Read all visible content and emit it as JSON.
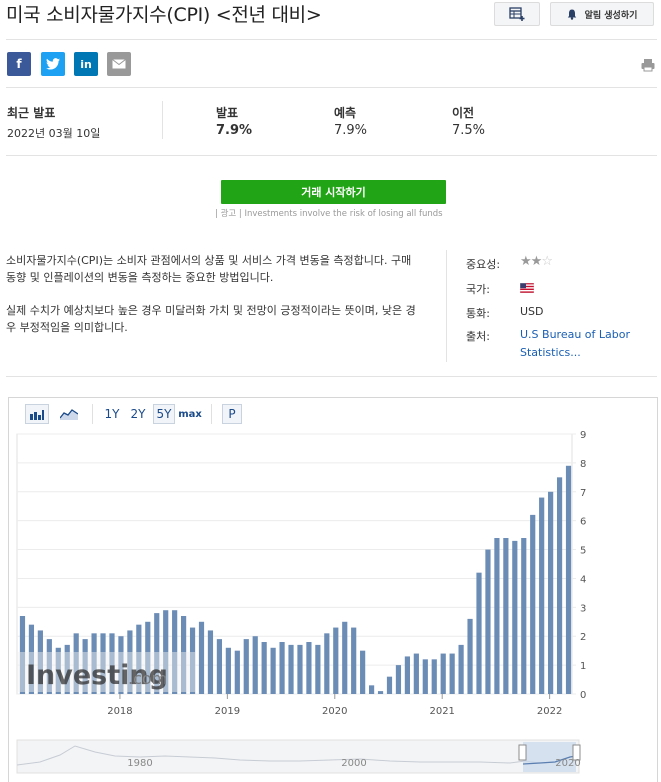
{
  "header": {
    "title": "미국 소비자물가지수(CPI) <전년 대비>",
    "alert_label": "알림 생성하기"
  },
  "share": {
    "facebook": "f",
    "twitter": "t",
    "linkedin": "in"
  },
  "stats": {
    "latest_label": "최근 발표",
    "latest_date": "2022년 03월 10일",
    "actual_label": "발표",
    "actual_value": "7.9%",
    "forecast_label": "예측",
    "forecast_value": "7.9%",
    "previous_label": "이전",
    "previous_value": "7.5%"
  },
  "cta": {
    "label": "거래 시작하기",
    "disclaimer": "| 광고 | Investments involve the risk of losing all funds"
  },
  "description": {
    "p1": "소비자물가지수(CPI)는 소비자 관점에서의 상품 및 서비스 가격 변동을 측정합니다. 구매 동향 및 인플레이션의 변동을 측정하는 중요한 방법입니다.",
    "p2": "실제 수치가 예상치보다 높은 경우 미달러화 가치 및 전망이 긍정적이라는 뜻이며, 낮은 경우 부정적임을 의미합니다."
  },
  "info": {
    "importance_label": "중요성:",
    "importance_stars": 2,
    "country_label": "국가:",
    "currency_label": "통화:",
    "currency_value": "USD",
    "source_label": "출처:",
    "source_value": "U.S Bureau of Labor Statistics..."
  },
  "toolbar": {
    "range_1y": "1Y",
    "range_2y": "2Y",
    "range_5y": "5Y",
    "range_max": "max",
    "p_label": "P",
    "active_range": "5Y"
  },
  "watermark": {
    "brand": "Investing",
    "suffix": ".com"
  },
  "chart_data": {
    "type": "bar",
    "y_ticks": [
      "0",
      "1",
      "2",
      "3",
      "4",
      "5",
      "6",
      "7",
      "8",
      "9"
    ],
    "ylim": [
      0,
      9
    ],
    "x_ticks": [
      "2018",
      "2019",
      "2020",
      "2021",
      "2022"
    ],
    "color": "#6b8cb5",
    "series": [
      {
        "values": [
          2.7,
          2.4,
          2.2,
          1.9,
          1.6,
          1.7,
          2.1,
          1.9,
          2.1,
          2.1,
          2.1,
          2.0,
          2.2,
          2.4,
          2.5,
          2.8,
          2.9,
          2.9,
          2.7,
          2.3,
          2.5,
          2.2,
          1.9,
          1.6,
          1.5,
          1.9,
          2.0,
          1.8,
          1.6,
          1.8,
          1.7,
          1.7,
          1.8,
          1.7,
          2.1,
          2.3,
          2.5,
          2.3,
          1.5,
          0.3,
          0.1,
          0.6,
          1.0,
          1.3,
          1.4,
          1.2,
          1.2,
          1.4,
          1.4,
          1.7,
          2.6,
          4.2,
          5.0,
          5.4,
          5.4,
          5.3,
          5.4,
          6.2,
          6.8,
          7.0,
          7.5,
          7.9
        ]
      }
    ],
    "navigator_ticks": [
      "1980",
      "2000",
      "2020"
    ]
  },
  "colors": {
    "accent_green": "#21a415",
    "facebook": "#3b5998",
    "twitter": "#1da1f2",
    "linkedin": "#0077b5",
    "email": "#999999",
    "link": "#1a5fb4"
  }
}
